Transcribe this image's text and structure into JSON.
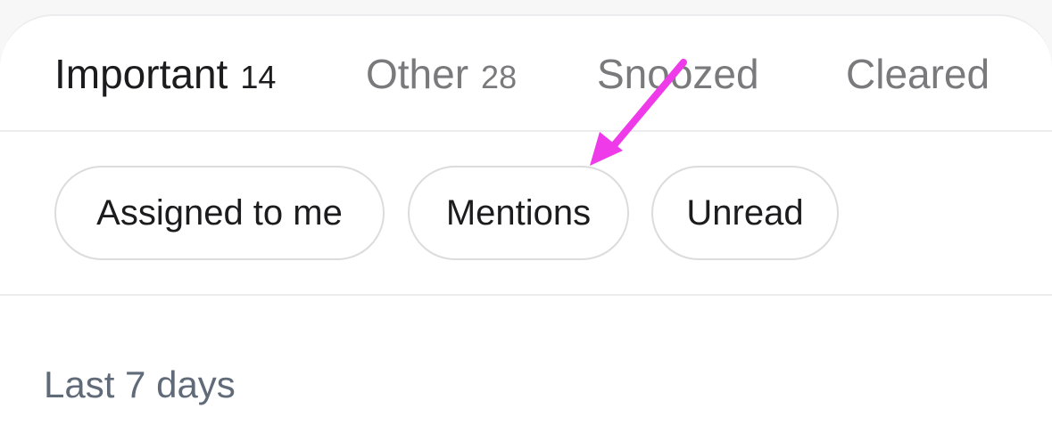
{
  "tabs": [
    {
      "label": "Important",
      "count": "14",
      "active": true
    },
    {
      "label": "Other",
      "count": "28",
      "active": false
    },
    {
      "label": "Snoozed",
      "count": "",
      "active": false
    },
    {
      "label": "Cleared",
      "count": "",
      "active": false
    }
  ],
  "filters": [
    {
      "label": "Assigned to me"
    },
    {
      "label": "Mentions"
    },
    {
      "label": "Unread"
    }
  ],
  "section_header": "Last 7 days",
  "colors": {
    "annotation_arrow": "#ee3ae8",
    "active_text": "#1c1c1e",
    "inactive_text": "#7a7a7d",
    "section_text": "#606a78",
    "divider": "#ececee",
    "chip_border": "#dcdcdf"
  }
}
